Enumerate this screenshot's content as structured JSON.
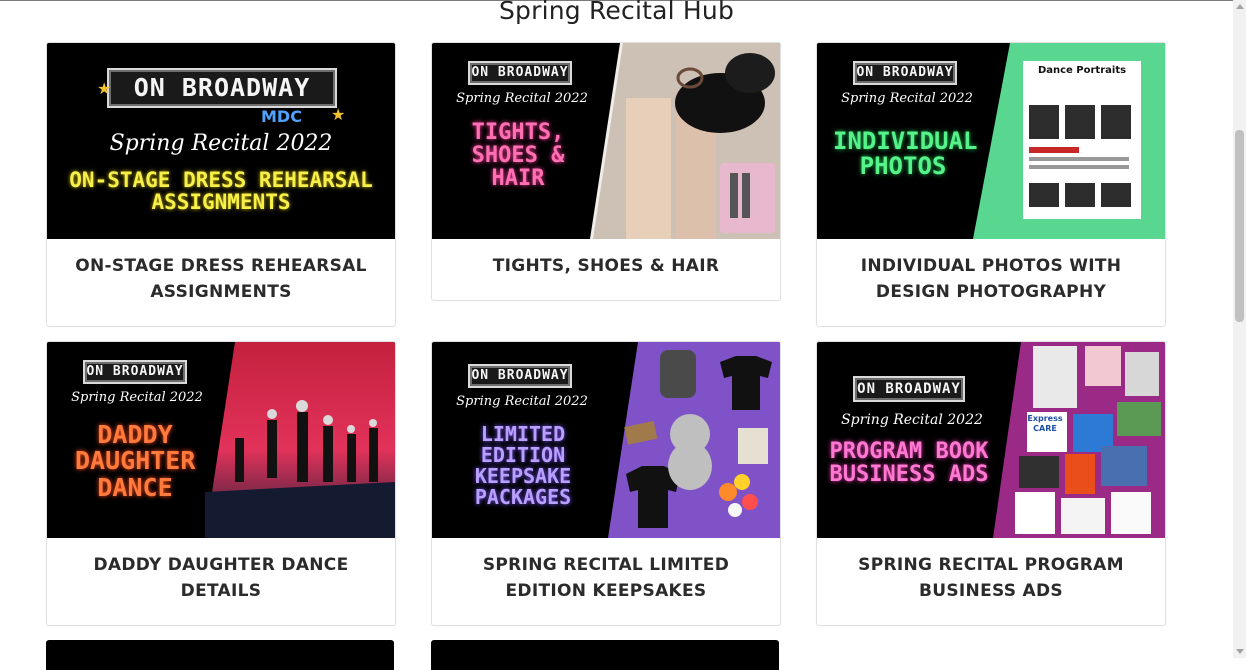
{
  "page": {
    "title": "Spring Recital Hub"
  },
  "colors": {
    "neon_yellow": "#f7ef4a",
    "neon_pink": "#ff6fb3",
    "neon_green": "#56f28a",
    "neon_orange": "#ff7a3d",
    "neon_purple": "#b9a0ff",
    "neon_magenta": "#ff78d2"
  },
  "banner": {
    "marquee": "ON BROADWAY",
    "subtitle": "Spring Recital 2022",
    "logo": "MDC"
  },
  "cards": [
    {
      "title": "ON-STAGE DRESS REHEARSAL ASSIGNMENTS",
      "neon": "ON-STAGE DRESS REHEARSAL ASSIGNMENTS"
    },
    {
      "title": "TIGHTS, SHOES & HAIR",
      "neon": "TIGHTS, SHOES & HAIR"
    },
    {
      "title": "INDIVIDUAL PHOTOS WITH DESIGN PHOTOGRAPHY",
      "neon": "INDIVIDUAL PHOTOS",
      "flyer_heading": "Dance Portraits"
    },
    {
      "title": "DADDY DAUGHTER DANCE DETAILS",
      "neon": "DADDY DAUGHTER DANCE"
    },
    {
      "title": "SPRING RECITAL LIMITED EDITION KEEPSAKES",
      "neon": "LIMITED EDITION KEEPSAKE PACKAGES"
    },
    {
      "title": "SPRING RECITAL PROGRAM BUSINESS ADS",
      "neon": "PROGRAM BOOK BUSINESS ADS",
      "ad_text": "Express CARE"
    }
  ]
}
